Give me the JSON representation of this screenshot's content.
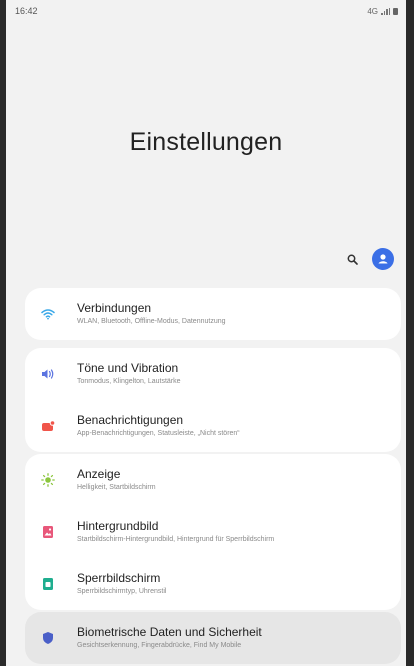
{
  "status_bar": {
    "time": "16:42",
    "network": "4G"
  },
  "header": {
    "title": "Einstellungen"
  },
  "groups": [
    {
      "items": [
        {
          "title": "Verbindungen",
          "subtitle": "WLAN, Bluetooth, Offline-Modus, Datennutzung",
          "icon": "wifi-icon",
          "color": "#3aa8e8"
        }
      ]
    },
    {
      "items": [
        {
          "title": "Töne und Vibration",
          "subtitle": "Tonmodus, Klingelton, Lautstärke",
          "icon": "volume-icon",
          "color": "#5b74e0"
        },
        {
          "title": "Benachrichtigungen",
          "subtitle": "App-Benachrichtigungen, Statusleiste, „Nicht stören“",
          "icon": "notification-icon",
          "color": "#f0554a"
        }
      ]
    },
    {
      "items": [
        {
          "title": "Anzeige",
          "subtitle": "Helligkeit, Startbildschirm",
          "icon": "brightness-icon",
          "color": "#8cc63f"
        },
        {
          "title": "Hintergrundbild",
          "subtitle": "Startbildschirm-Hintergrundbild, Hintergrund für Sperrbildschirm",
          "icon": "wallpaper-icon",
          "color": "#e8577a"
        },
        {
          "title": "Sperrbildschirm",
          "subtitle": "Sperrbildschirmtyp, Uhrenstil",
          "icon": "lockscreen-icon",
          "color": "#1fae8f"
        }
      ]
    },
    {
      "items": [
        {
          "title": "Biometrische Daten und Sicherheit",
          "subtitle": "Gesichtserkennung, Fingerabdrücke, Find My Mobile",
          "icon": "shield-icon",
          "color": "#4a5fc8"
        }
      ]
    }
  ]
}
